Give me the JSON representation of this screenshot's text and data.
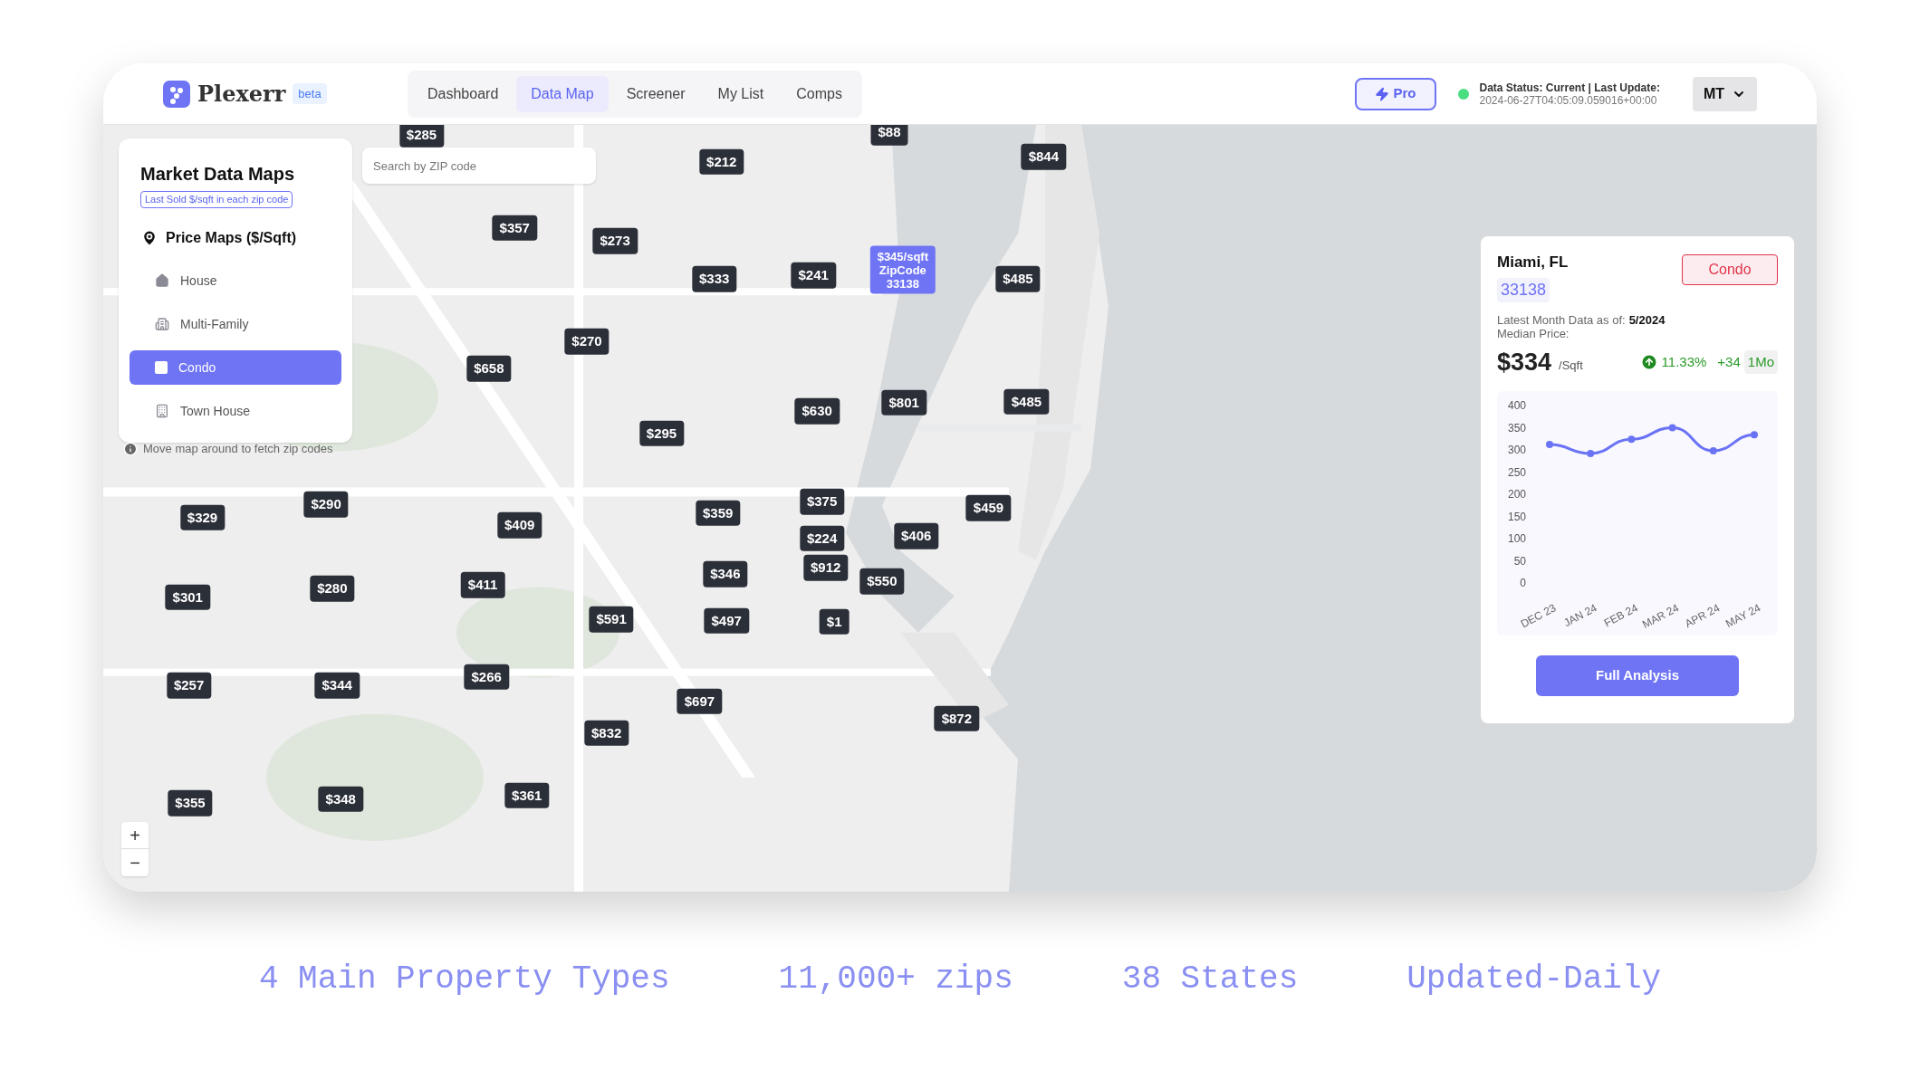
{
  "header": {
    "logo": "Plexerr",
    "badge": "beta",
    "nav": [
      {
        "label": "Dashboard",
        "selected": false
      },
      {
        "label": "Data Map",
        "selected": true
      },
      {
        "label": "Screener",
        "selected": false
      },
      {
        "label": "My List",
        "selected": false
      },
      {
        "label": "Comps",
        "selected": false
      }
    ],
    "pro_button": "Pro",
    "status": {
      "online": true,
      "title": "Data Status: Current | Last Update:",
      "timestamp": "2024-06-27T04:05:09.059016+00:00"
    },
    "user_menu": "MT"
  },
  "sidebar": {
    "title": "Market Data Maps",
    "subtitle": "Last Sold $/sqft in each zip code",
    "section": "Price Maps ($/Sqft)",
    "items": [
      {
        "kind": "house",
        "label": "House",
        "selected": false
      },
      {
        "kind": "multi_family",
        "label": "Multi-Family",
        "selected": false
      },
      {
        "kind": "condo",
        "label": "Condo",
        "selected": true
      },
      {
        "kind": "town_house",
        "label": "Town House",
        "selected": false
      }
    ]
  },
  "map": {
    "search": {
      "placeholder": "Search by ZIP code"
    },
    "hint": "Move map around to fetch zip codes",
    "zoom_controls": [
      "+",
      "−"
    ],
    "markers": [
      {
        "label": "$285",
        "selected": false
      },
      {
        "label": "$88",
        "selected": false
      },
      {
        "label": "$212",
        "selected": false
      },
      {
        "label": "$844",
        "selected": false
      },
      {
        "label": "$357",
        "selected": false
      },
      {
        "label": "$273",
        "selected": false
      },
      {
        "label": "$333",
        "selected": false
      },
      {
        "label": "$241",
        "selected": false
      },
      {
        "label": "$345/sqft",
        "zip_label": "ZipCode",
        "zip": "33138",
        "selected": true
      },
      {
        "label": "$485",
        "selected": false
      },
      {
        "label": "$270",
        "selected": false
      },
      {
        "label": "$658",
        "selected": false
      },
      {
        "label": "$630",
        "selected": false
      },
      {
        "label": "$801",
        "selected": false
      },
      {
        "label": "$485",
        "selected": false
      },
      {
        "label": "$295",
        "selected": false
      },
      {
        "label": "$329",
        "selected": false
      },
      {
        "label": "$290",
        "selected": false
      },
      {
        "label": "$409",
        "selected": false
      },
      {
        "label": "$359",
        "selected": false
      },
      {
        "label": "$375",
        "selected": false
      },
      {
        "label": "$459",
        "selected": false
      },
      {
        "label": "$224",
        "selected": false
      },
      {
        "label": "$406",
        "selected": false
      },
      {
        "label": "$301",
        "selected": false
      },
      {
        "label": "$280",
        "selected": false
      },
      {
        "label": "$411",
        "selected": false
      },
      {
        "label": "$346",
        "selected": false
      },
      {
        "label": "$912",
        "selected": false
      },
      {
        "label": "$550",
        "selected": false
      },
      {
        "label": "$591",
        "selected": false
      },
      {
        "label": "$497",
        "selected": false
      },
      {
        "label": "$1",
        "selected": false
      },
      {
        "label": "$257",
        "selected": false
      },
      {
        "label": "$344",
        "selected": false
      },
      {
        "label": "$266",
        "selected": false
      },
      {
        "label": "$697",
        "selected": false
      },
      {
        "label": "$832",
        "selected": false
      },
      {
        "label": "$872",
        "selected": false
      },
      {
        "label": "$355",
        "selected": false
      },
      {
        "label": "$348",
        "selected": false
      },
      {
        "label": "$361",
        "selected": false
      }
    ]
  },
  "detail": {
    "city": "Miami, FL",
    "zip": "33138",
    "type_badge": "Condo",
    "as_of_label": "Latest Month Data as of:",
    "as_of": "5/2024",
    "median_label": "Median Price:",
    "price": "$334",
    "unit": "/Sqft",
    "change_pct": "11.33%",
    "change_abs": "+34",
    "period": "1Mo",
    "chart_data": {
      "type": "line",
      "categories": [
        "DEC 23",
        "JAN 24",
        "FEB 24",
        "MAR 24",
        "APR 24",
        "MAY 24"
      ],
      "series": [
        {
          "color": "#6b73f5",
          "marker": true,
          "values": [
            312,
            292,
            324,
            350,
            298,
            334
          ]
        }
      ],
      "ylim": [
        0,
        400
      ],
      "yticks": [
        0,
        50,
        100,
        150,
        200,
        250,
        300,
        350,
        400
      ]
    },
    "button": "Full Analysis"
  },
  "features": [
    "4 Main Property Types",
    "11,000+ zips",
    "38 States",
    "Updated-Daily"
  ]
}
